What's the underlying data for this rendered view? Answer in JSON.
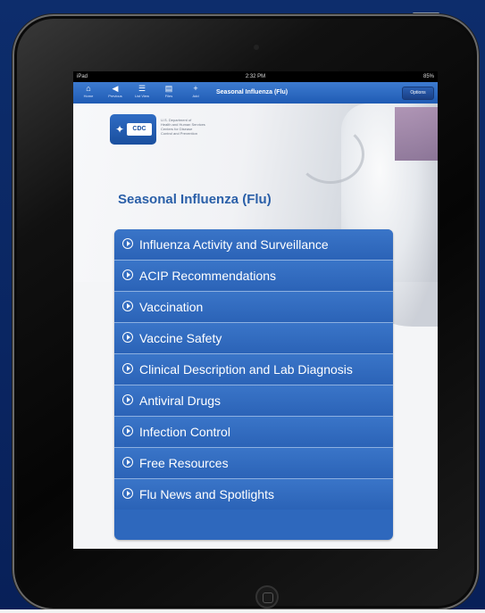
{
  "status_bar": {
    "carrier": "iPad",
    "time": "2:32 PM",
    "battery": "85%"
  },
  "toolbar": {
    "buttons": [
      {
        "icon": "home-icon",
        "glyph": "⌂",
        "label": "Home"
      },
      {
        "icon": "back-icon",
        "glyph": "◀",
        "label": "Previous"
      },
      {
        "icon": "list-icon",
        "glyph": "☰",
        "label": "List View"
      },
      {
        "icon": "files-icon",
        "glyph": "▤",
        "label": "Files"
      },
      {
        "icon": "plus-icon",
        "glyph": "+",
        "label": "Add"
      }
    ],
    "title": "Seasonal Influenza (Flu)",
    "options_label": "Options"
  },
  "cdc": {
    "badge_text": "CDC",
    "agency_lines": [
      "U.S. Department of",
      "Health and Human Services",
      "Centers for Disease",
      "Control and Prevention"
    ]
  },
  "page_title": "Seasonal Influenza (Flu)",
  "menu": [
    "Influenza Activity and Surveillance",
    "ACIP Recommendations",
    "Vaccination",
    "Vaccine Safety",
    "Clinical Description and Lab Diagnosis",
    "Antiviral Drugs",
    "Infection Control",
    "Free Resources",
    "Flu News and Spotlights"
  ]
}
